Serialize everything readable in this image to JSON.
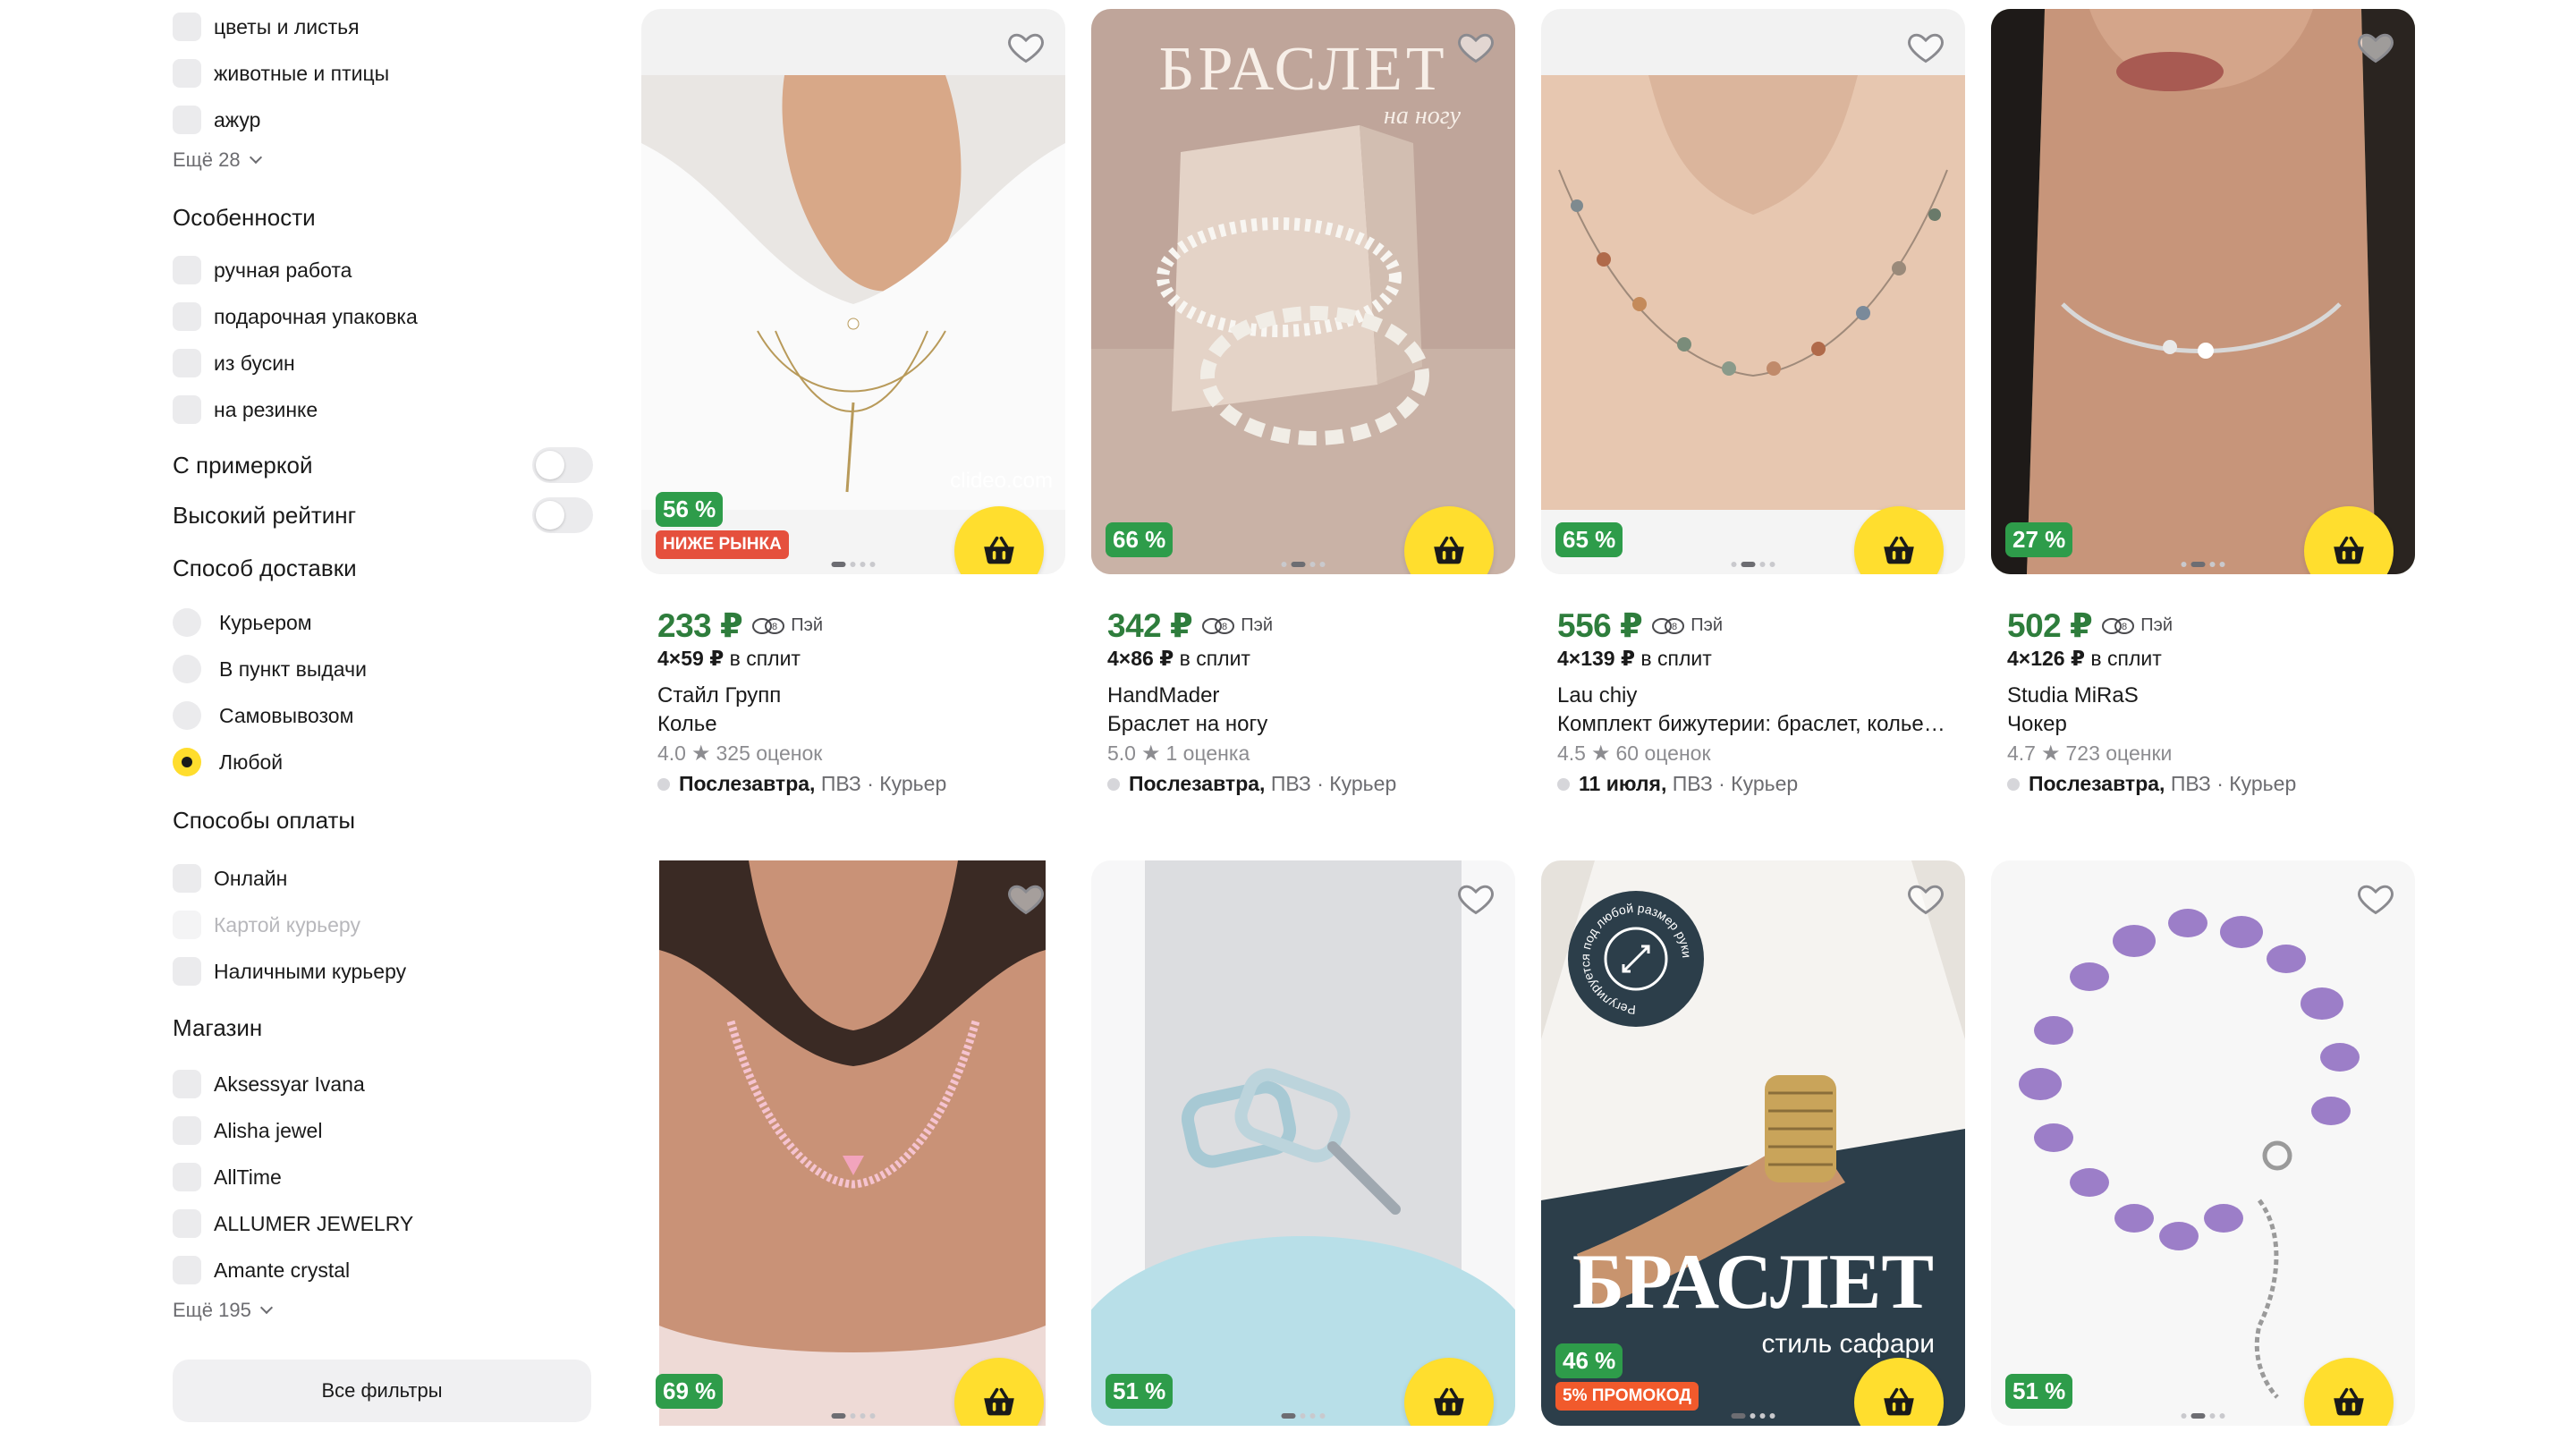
{
  "filters": {
    "patterns": [
      "цветы и листья",
      "животные и птицы",
      "ажур"
    ],
    "patterns_more": "Ещё 28",
    "features_title": "Особенности",
    "features": [
      "ручная работа",
      "подарочная упаковка",
      "из бусин",
      "на резинке"
    ],
    "fitting_label": "С примеркой",
    "high_rating_label": "Высокий рейтинг",
    "delivery_title": "Способ доставки",
    "delivery_options": [
      "Курьером",
      "В пункт выдачи",
      "Самовывозом",
      "Любой"
    ],
    "delivery_selected": "Любой",
    "payment_title": "Способы оплаты",
    "payment_options": [
      "Онлайн",
      "Картой курьеру",
      "Наличными курьеру"
    ],
    "payment_disabled": "Картой курьеру",
    "shop_title": "Магазин",
    "shops": [
      "Aksessyar Ivana",
      "Alisha jewel",
      "AllTime",
      "ALLUMER JEWELRY",
      "Amante crystal"
    ],
    "shops_more": "Ещё 195",
    "all_filters_button": "Все фильтры"
  },
  "products": [
    {
      "discount": "56 %",
      "tag": "НИЖЕ РЫНКА",
      "watermark": "clideo.com",
      "price": "233 ₽",
      "pay": "Пэй",
      "split_amount": "4×59 ₽",
      "split_label": "в сплит",
      "seller": "Стайл Групп",
      "name": "Колье",
      "rating": "4.0",
      "reviews": "325 оценок",
      "delivery_date": "Послезавтра,",
      "delivery_ways": "ПВЗ · Курьер"
    },
    {
      "discount": "66 %",
      "overlay_title": "БРАСЛЕТ",
      "overlay_sub": "на ногу",
      "price": "342 ₽",
      "pay": "Пэй",
      "split_amount": "4×86 ₽",
      "split_label": "в сплит",
      "seller": "HandMader",
      "name": "Браслет на ногу",
      "rating": "5.0",
      "reviews": "1 оценка",
      "delivery_date": "Послезавтра,",
      "delivery_ways": "ПВЗ · Курьер"
    },
    {
      "discount": "65 %",
      "price": "556 ₽",
      "pay": "Пэй",
      "split_amount": "4×139 ₽",
      "split_label": "в сплит",
      "seller": "Lau chiy",
      "name": "Комплект бижутерии: браслет, колье, серьги",
      "rating": "4.5",
      "reviews": "60 оценок",
      "delivery_date": "11 июля,",
      "delivery_ways": "ПВЗ · Курьер"
    },
    {
      "discount": "27 %",
      "price": "502 ₽",
      "pay": "Пэй",
      "split_amount": "4×126 ₽",
      "split_label": "в сплит",
      "seller": "Studia MiRaS",
      "name": "Чокер",
      "rating": "4.7",
      "reviews": "723 оценки",
      "delivery_date": "Послезавтра,",
      "delivery_ways": "ПВЗ · Курьер"
    },
    {
      "discount": "69 %"
    },
    {
      "discount": "51 %"
    },
    {
      "discount": "46 %",
      "tag": "5% ПРОМОКОД",
      "overlay_title": "БРАСЛЕТ",
      "overlay_sub": "стиль сафари",
      "stamp_text": "Регулируется под любой размер руки"
    },
    {
      "discount": "51 %"
    }
  ],
  "colors": {
    "accent_yellow": "#ffde2e",
    "price_green": "#2e7d3c",
    "discount_green": "#2e9c4a",
    "tag_red": "#e5503d"
  }
}
